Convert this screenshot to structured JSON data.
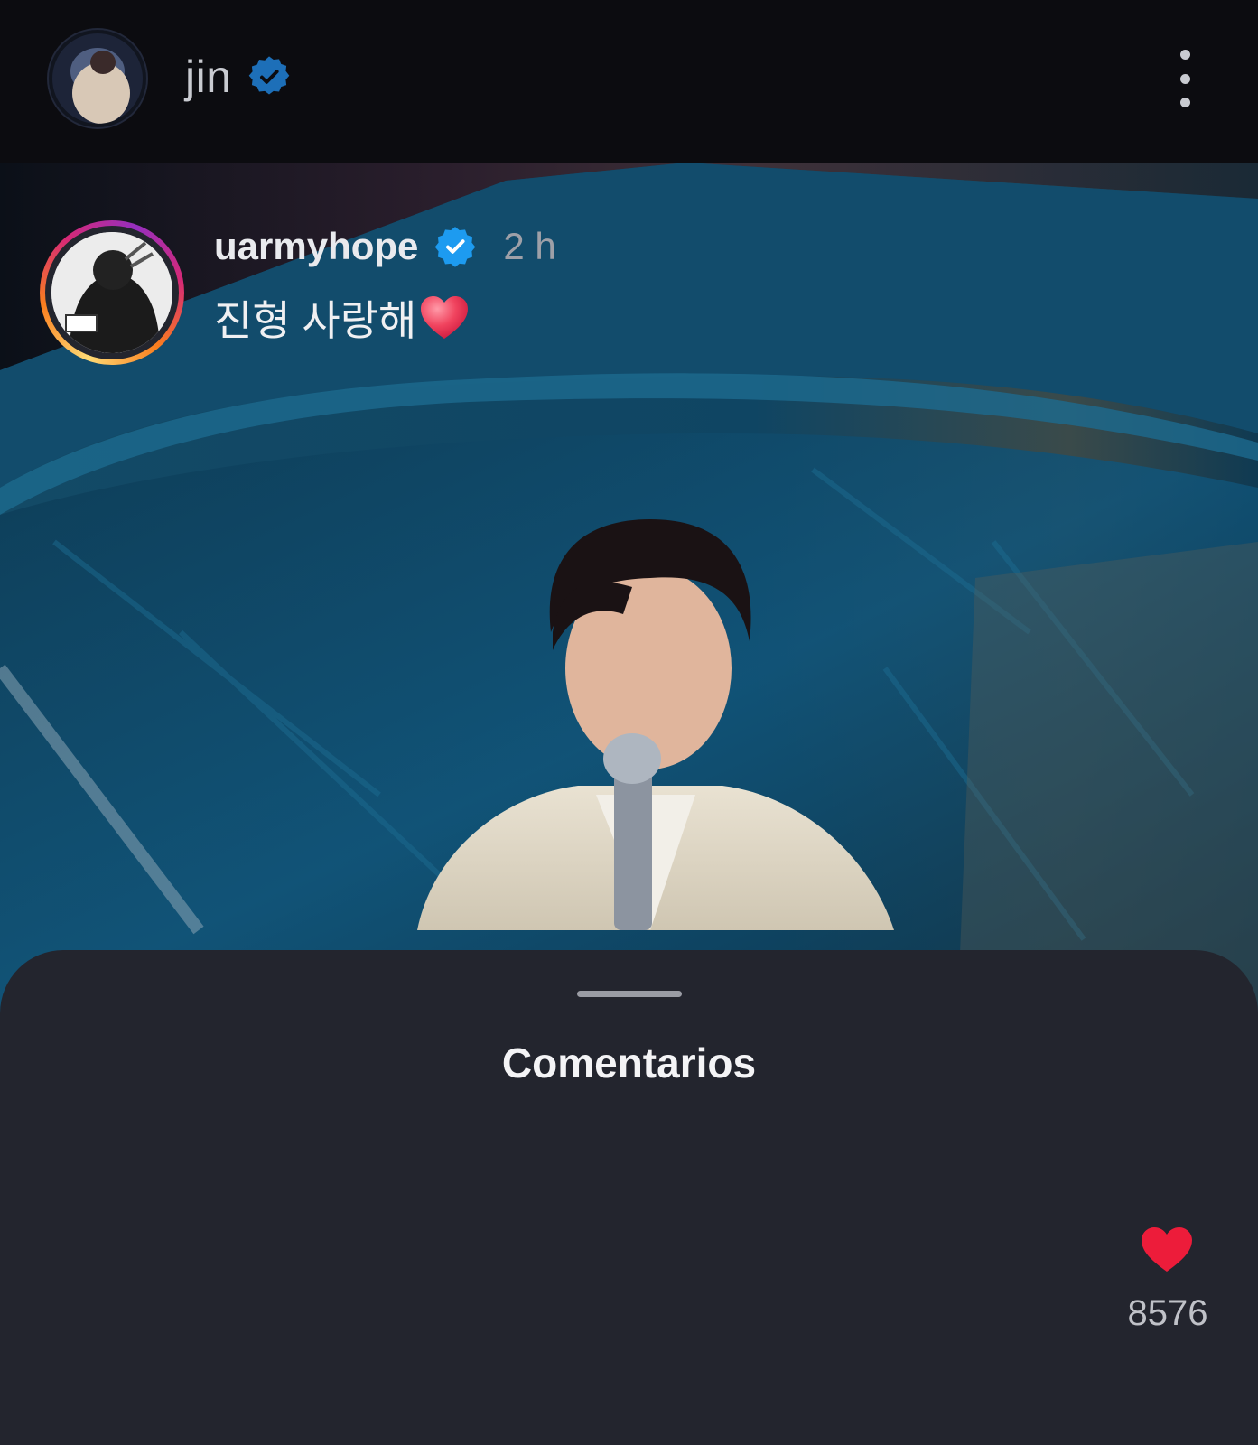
{
  "header": {
    "username": "jin",
    "verified": true,
    "avatar_icon": "profile-photo",
    "menu_icon": "more-vertical-icon"
  },
  "post": {
    "media_icon": "photo"
  },
  "comments_sheet": {
    "title": "Comentarios",
    "comments": [
      {
        "username": "uarmyhope",
        "verified": true,
        "time": "2 h",
        "text": "진형 사랑해",
        "emoji": "red-heart-emoji",
        "likes": "8576",
        "liked": true,
        "like_color": "#ed1c3a"
      }
    ]
  },
  "colors": {
    "verified_blue": "#1d9bf0",
    "sheet_bg": "#23252e",
    "header_bg": "#0c0c10"
  }
}
